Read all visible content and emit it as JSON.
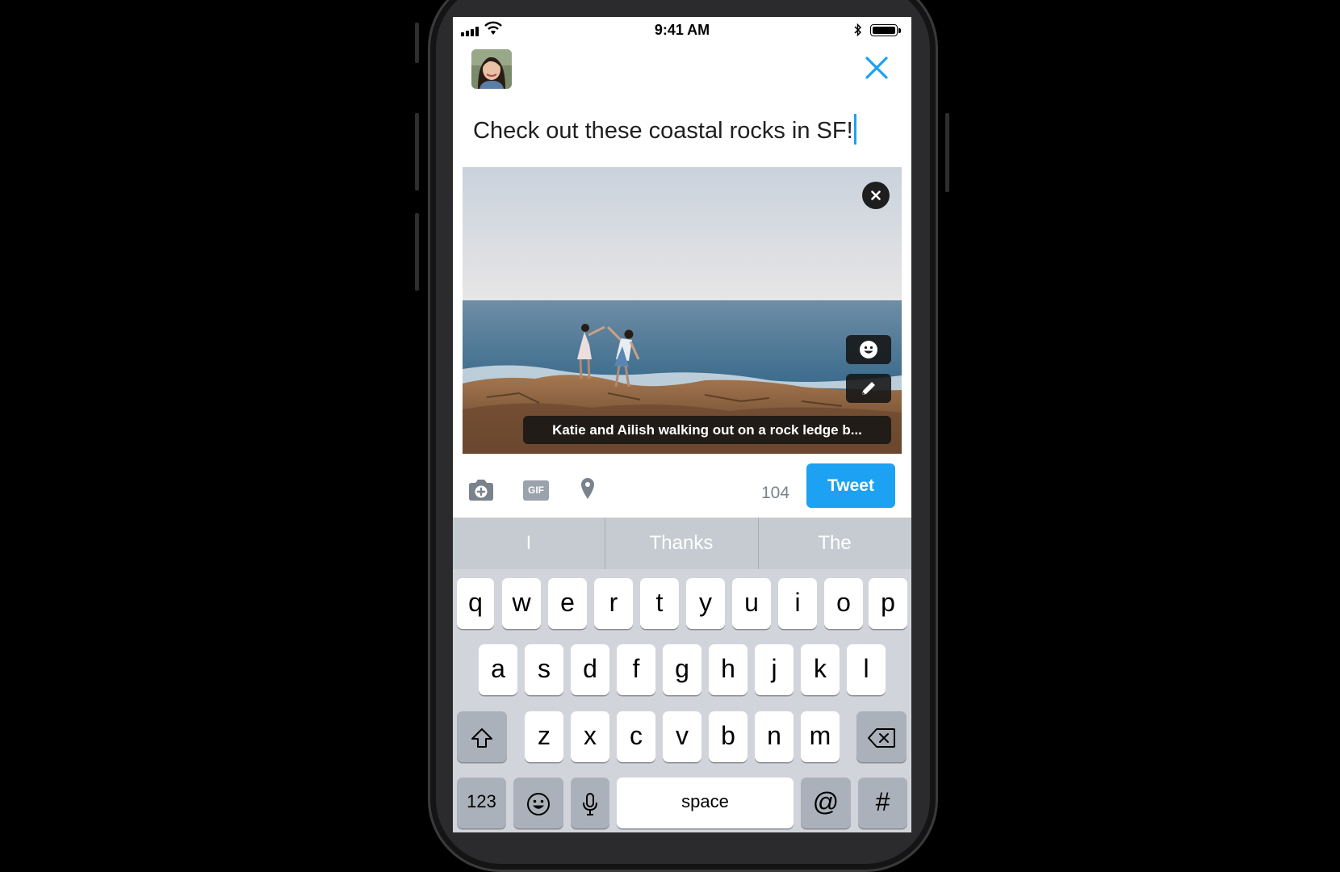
{
  "status_bar": {
    "time": "9:41 AM"
  },
  "compose": {
    "text": "Check out these coastal rocks in SF!",
    "alt_text": "Katie and Ailish walking out on a rock ledge b..."
  },
  "toolbar": {
    "char_count": "104",
    "tweet_label": "Tweet",
    "gif_label": "GIF"
  },
  "keyboard": {
    "suggestions": [
      "I",
      "Thanks",
      "The"
    ],
    "row1": [
      "q",
      "w",
      "e",
      "r",
      "t",
      "y",
      "u",
      "i",
      "o",
      "p"
    ],
    "row2": [
      "a",
      "s",
      "d",
      "f",
      "g",
      "h",
      "j",
      "k",
      "l"
    ],
    "row3": [
      "z",
      "x",
      "c",
      "v",
      "b",
      "n",
      "m"
    ],
    "numbers_label": "123",
    "space_label": "space",
    "at_label": "@",
    "hash_label": "#"
  },
  "icons": [
    "signal-icon",
    "wifi-icon",
    "bluetooth-icon",
    "battery-icon",
    "close-icon",
    "remove-photo-icon",
    "sticker-icon",
    "edit-icon",
    "camera-icon",
    "gif-icon",
    "location-icon",
    "shift-icon",
    "backspace-icon",
    "emoji-icon",
    "microphone-icon"
  ],
  "colors": {
    "accent": "#1da1f2",
    "keyboard_bg": "#d1d5db",
    "counter": "#7a838c"
  }
}
